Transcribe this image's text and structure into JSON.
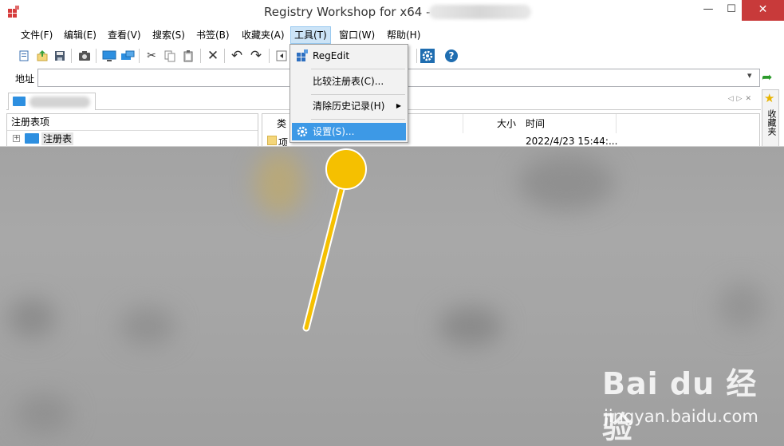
{
  "window": {
    "title": "Registry Workshop for x64 -",
    "controls": {
      "minimize": "—",
      "maximize": "☐",
      "close": "✕"
    }
  },
  "menubar": {
    "items": [
      {
        "label": "文件(F)"
      },
      {
        "label": "编辑(E)"
      },
      {
        "label": "查看(V)"
      },
      {
        "label": "搜索(S)"
      },
      {
        "label": "书签(B)"
      },
      {
        "label": "收藏夹(A)"
      },
      {
        "label": "工具(T)",
        "active": true
      },
      {
        "label": "窗口(W)"
      },
      {
        "label": "帮助(H)"
      }
    ]
  },
  "toolbar": {
    "icons": [
      "new-key-icon",
      "import-icon",
      "save-icon",
      "snapshot-icon",
      "computer-icon",
      "remote-connect-icon",
      "cut-icon",
      "copy-icon",
      "paste-icon",
      "delete-icon",
      "undo-icon",
      "redo-icon",
      "back-icon",
      "settings-icon",
      "help-icon"
    ]
  },
  "address": {
    "label": "地址",
    "value": ""
  },
  "favorites": {
    "label": "收藏夹"
  },
  "left_pane": {
    "header": "注册表项",
    "tree": [
      {
        "label": "注册表",
        "expand": "+"
      }
    ]
  },
  "right_pane": {
    "columns": {
      "type": "类",
      "size": "大小",
      "time": "时间"
    },
    "rows": [
      {
        "type": "项",
        "time": "2022/4/23 15:44:..."
      }
    ]
  },
  "tools_menu": {
    "items": [
      {
        "label": "RegEdit"
      },
      {
        "label": "比较注册表(C)..."
      },
      {
        "label": "清除历史记录(H)",
        "submenu": "▶"
      },
      {
        "label": "设置(S)...",
        "highlighted": true
      }
    ]
  },
  "watermark": {
    "logo": "Bai du 经验",
    "url": "jingyan.baidu.com"
  },
  "colors": {
    "accent": "#3d99e6",
    "pointer": "#f5c000",
    "close": "#c83a3a"
  }
}
